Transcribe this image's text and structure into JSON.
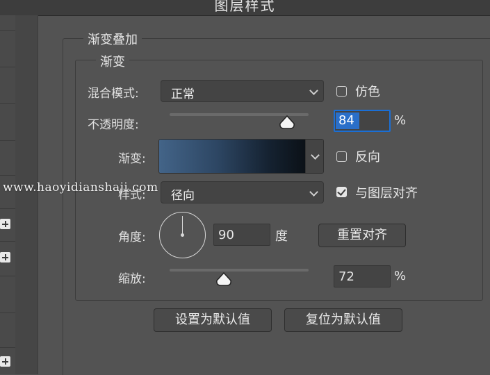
{
  "window": {
    "title": "图层样式"
  },
  "section": {
    "title": "渐变叠加",
    "group_title": "渐变",
    "blend_mode": {
      "label": "混合模式:",
      "value": "正常"
    },
    "dither": {
      "label": "仿色",
      "checked": false
    },
    "opacity": {
      "label": "不透明度:",
      "value": "84",
      "unit": "%"
    },
    "gradient": {
      "label": "渐变:",
      "colors": [
        "#436488",
        "#2d4663",
        "#152231",
        "#0b1117"
      ]
    },
    "reverse": {
      "label": "反向",
      "checked": false
    },
    "style": {
      "label": "样式:",
      "value": "径向"
    },
    "align_with_layer": {
      "label": "与图层对齐",
      "checked": true
    },
    "angle": {
      "label": "角度:",
      "value": "90",
      "unit": "度"
    },
    "reset_alignment": "重置对齐",
    "scale": {
      "label": "缩放:",
      "value": "72",
      "unit": "%"
    }
  },
  "buttons": {
    "make_default": "设置为默认值",
    "reset_to_default": "复位为默认值"
  },
  "watermark": "www.haoyidianshaji.com"
}
